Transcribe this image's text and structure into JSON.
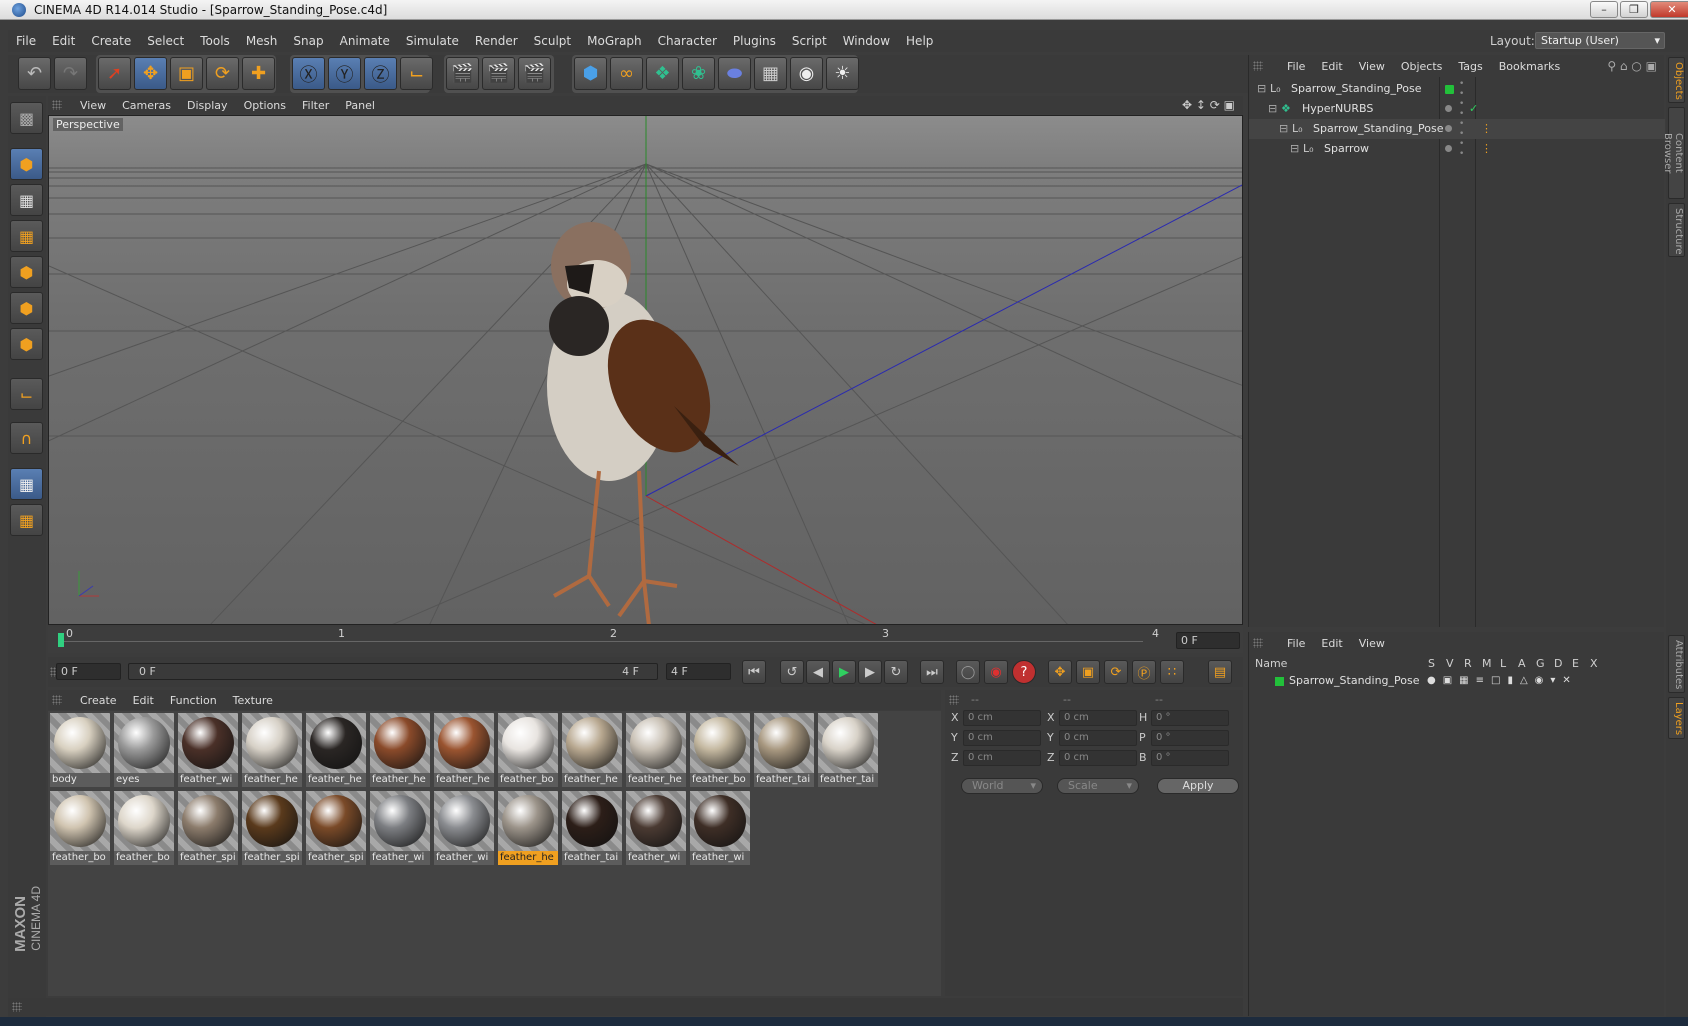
{
  "window": {
    "title": "CINEMA 4D R14.014 Studio - [Sparrow_Standing_Pose.c4d]"
  },
  "menu": [
    "File",
    "Edit",
    "Create",
    "Select",
    "Tools",
    "Mesh",
    "Snap",
    "Animate",
    "Simulate",
    "Render",
    "Sculpt",
    "MoGraph",
    "Character",
    "Plugins",
    "Script",
    "Window",
    "Help"
  ],
  "layout": {
    "label": "Layout:",
    "value": "Startup (User)"
  },
  "viewport": {
    "menu": [
      "View",
      "Cameras",
      "Display",
      "Options",
      "Filter",
      "Panel"
    ],
    "label": "Perspective"
  },
  "timeline": {
    "ticks": [
      "0",
      "1",
      "2",
      "3",
      "4"
    ],
    "end_field": "0 F"
  },
  "transport": {
    "current": "0 F",
    "range_start": "0 F",
    "range_end": "4 F",
    "max": "4 F"
  },
  "materials": {
    "menu": [
      "Create",
      "Edit",
      "Function",
      "Texture"
    ],
    "items": [
      {
        "label": "body",
        "color": "#d8d0c0"
      },
      {
        "label": "eyes",
        "color": "#9a9a9a"
      },
      {
        "label": "feather_wi",
        "color": "#4a3028"
      },
      {
        "label": "feather_he",
        "color": "#d6d0c6"
      },
      {
        "label": "feather_he",
        "color": "#2a2624"
      },
      {
        "label": "feather_he",
        "color": "#8a4a2a"
      },
      {
        "label": "feather_he",
        "color": "#9a5430"
      },
      {
        "label": "feather_bo",
        "color": "#e8e4e0"
      },
      {
        "label": "feather_he",
        "color": "#b8a890"
      },
      {
        "label": "feather_he",
        "color": "#c8c0b4"
      },
      {
        "label": "feather_bo",
        "color": "#c4b8a0"
      },
      {
        "label": "feather_tai",
        "color": "#a89880"
      },
      {
        "label": "feather_tai",
        "color": "#d8d2c8"
      },
      {
        "label": "feather_bo",
        "color": "#d0c4b0"
      },
      {
        "label": "feather_bo",
        "color": "#ddd6ca"
      },
      {
        "label": "feather_spi",
        "color": "#8c7c6c"
      },
      {
        "label": "feather_spi",
        "color": "#5a3a1c"
      },
      {
        "label": "feather_spi",
        "color": "#7a4a28"
      },
      {
        "label": "feather_wi",
        "color": "#7c7e82"
      },
      {
        "label": "feather_wi",
        "color": "#8a8c90"
      },
      {
        "label": "feather_he",
        "color": "#9c948a"
      },
      {
        "label": "feather_tai",
        "color": "#2c1e18"
      },
      {
        "label": "feather_wi",
        "color": "#4a3a32"
      },
      {
        "label": "feather_wi",
        "color": "#3e2e26"
      }
    ],
    "selected_index": 20
  },
  "coords": {
    "headers": [
      "--",
      "--",
      "--"
    ],
    "rows": [
      {
        "a": "X",
        "av": "0 cm",
        "b": "X",
        "bv": "0 cm",
        "c": "H",
        "cv": "0 °"
      },
      {
        "a": "Y",
        "av": "0 cm",
        "b": "Y",
        "bv": "0 cm",
        "c": "P",
        "cv": "0 °"
      },
      {
        "a": "Z",
        "av": "0 cm",
        "b": "Z",
        "bv": "0 cm",
        "c": "B",
        "cv": "0 °"
      }
    ],
    "mode1": "World",
    "mode2": "Scale",
    "apply": "Apply"
  },
  "objects": {
    "menu": [
      "File",
      "Edit",
      "View",
      "Objects",
      "Tags",
      "Bookmarks"
    ],
    "tree": [
      {
        "name": "Sparrow_Standing_Pose",
        "level": 0
      },
      {
        "name": "HyperNURBS",
        "level": 1
      },
      {
        "name": "Sparrow_Standing_Pose",
        "level": 2
      },
      {
        "name": "Sparrow",
        "level": 3
      }
    ]
  },
  "layers": {
    "menu": [
      "File",
      "Edit",
      "View"
    ],
    "header_name": "Name",
    "columns": [
      "S",
      "V",
      "R",
      "M",
      "L",
      "A",
      "G",
      "D",
      "E",
      "X"
    ],
    "rows": [
      {
        "name": "Sparrow_Standing_Pose",
        "color": "#22c03a"
      }
    ]
  },
  "side_tabs": [
    "Objects",
    "Content Browser",
    "Structure",
    "Attributes",
    "Layers"
  ],
  "brand": {
    "maxon": "MAXON",
    "cinema": "CINEMA 4D"
  },
  "colors": {
    "accent": "#f0a020",
    "selection": "#3b5a88",
    "bg": "#3c3c3c"
  }
}
